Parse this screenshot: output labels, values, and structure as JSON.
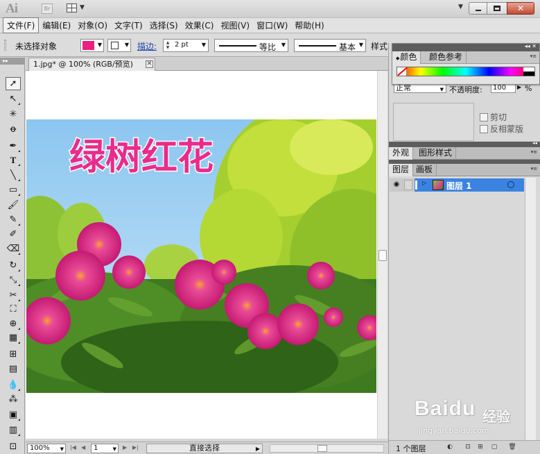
{
  "app": {
    "logo": "Ai",
    "bridge_label": "Br"
  },
  "menu": [
    "文件(F)",
    "编辑(E)",
    "对象(O)",
    "文字(T)",
    "选择(S)",
    "效果(C)",
    "视图(V)",
    "窗口(W)",
    "帮助(H)"
  ],
  "control": {
    "selection_label": "未选择对象",
    "fill_color": "#e9207f",
    "stroke_label": "描边:",
    "stroke_weight": "2 pt",
    "profile1": "等比",
    "profile2": "基本",
    "style_label": "样式:"
  },
  "document": {
    "tab_title": "1.jpg* @ 100% (RGB/预览)",
    "zoom": "100%",
    "page": "1",
    "status": "直接选择",
    "image_title": "绿树红花"
  },
  "color_panel": {
    "tabs": [
      "颜色",
      "颜色参考"
    ]
  },
  "transparency": {
    "blend_mode": "正常",
    "opacity_label": "不透明度:",
    "opacity_value": "100",
    "opacity_unit": "%",
    "clip_label": "剪切",
    "invert_label": "反相蒙版"
  },
  "appearance_tabs": [
    "外观",
    "图形样式"
  ],
  "layers": {
    "tabs": [
      "图层",
      "画板"
    ],
    "items": [
      {
        "name": "图层 1"
      }
    ],
    "count_label": "1 个图层"
  },
  "watermark": {
    "brand": "Baidu",
    "brand_cn": "经验",
    "url": "jingyan.baidu.com"
  },
  "accent_color": "#3b83e0"
}
